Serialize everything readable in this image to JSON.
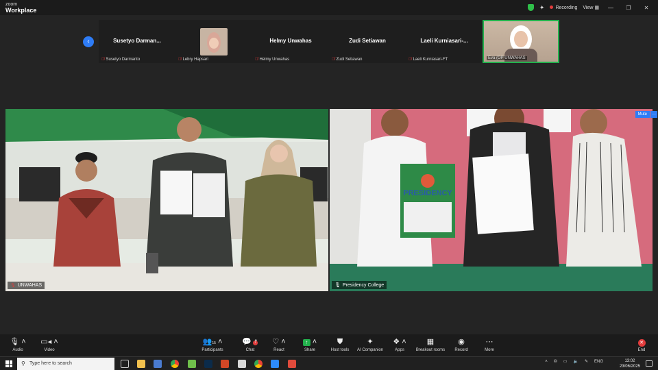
{
  "app": {
    "logo_top": "zoom",
    "logo_bottom": "Workplace"
  },
  "titlebar": {
    "recording": "Recording",
    "view": "View",
    "minimize": "—",
    "restore": "❐",
    "close": "✕"
  },
  "thumbnails": [
    {
      "display_name": "Susetyo  Darman...",
      "label": "Susetyo Darmanto",
      "video": false
    },
    {
      "display_name": "",
      "label": "Lebry Hapsari",
      "video": true
    },
    {
      "display_name": "Helmy Unwahas",
      "label": "Helmy Unwahas",
      "video": false
    },
    {
      "display_name": "Zudi Setiawan",
      "label": "Zudi Setiawan",
      "video": false
    },
    {
      "display_name": "Laeli  Kurniasari-...",
      "label": "Laeli Kurniasari-FT",
      "video": false
    },
    {
      "display_name": "",
      "label": "Eva (OP UNWAHAS",
      "video": true
    }
  ],
  "videos": {
    "left_label": "UNWAHAS",
    "right_label": "Presidency College",
    "right_mute": "Mute",
    "right_more": "···",
    "left_folder_text": "",
    "right_folder_text": "PRESIDENCY"
  },
  "toolbar": {
    "audio": "Audio",
    "video": "Video",
    "participants": "Participants",
    "participants_count": "15",
    "chat": "Chat",
    "chat_badge": "1",
    "react": "React",
    "share": "Share",
    "host_tools": "Host tools",
    "ai_companion": "AI Companion",
    "apps": "Apps",
    "breakout": "Breakout rooms",
    "record": "Record",
    "more": "More",
    "end": "End"
  },
  "taskbar": {
    "search_placeholder": "Type here to search",
    "lang": "ENG",
    "time": "13:02",
    "date": "23/06/2025"
  },
  "colors": {
    "accent_blue": "#2e7cf6",
    "active_green": "#23b14d",
    "record_red": "#e23c3c"
  }
}
